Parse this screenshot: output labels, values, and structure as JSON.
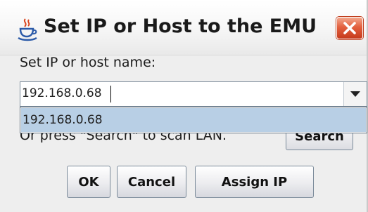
{
  "window": {
    "title": "Set IP or Host to the EMU",
    "icon": "java-coffee-icon",
    "close_icon": "close-icon"
  },
  "form": {
    "label": "Set IP or host name:",
    "combo_value": "192.168.0.68",
    "dropdown_options": [
      "192.168.0.68"
    ],
    "hint_text": "Or press \"Search\" to scan LAN.",
    "search_label": "Search"
  },
  "buttons": {
    "ok": "OK",
    "cancel": "Cancel",
    "assign": "Assign IP"
  },
  "colors": {
    "close_button": "#d9502e",
    "dropdown_highlight": "#b8cfe5",
    "background": "#eeeeee"
  }
}
